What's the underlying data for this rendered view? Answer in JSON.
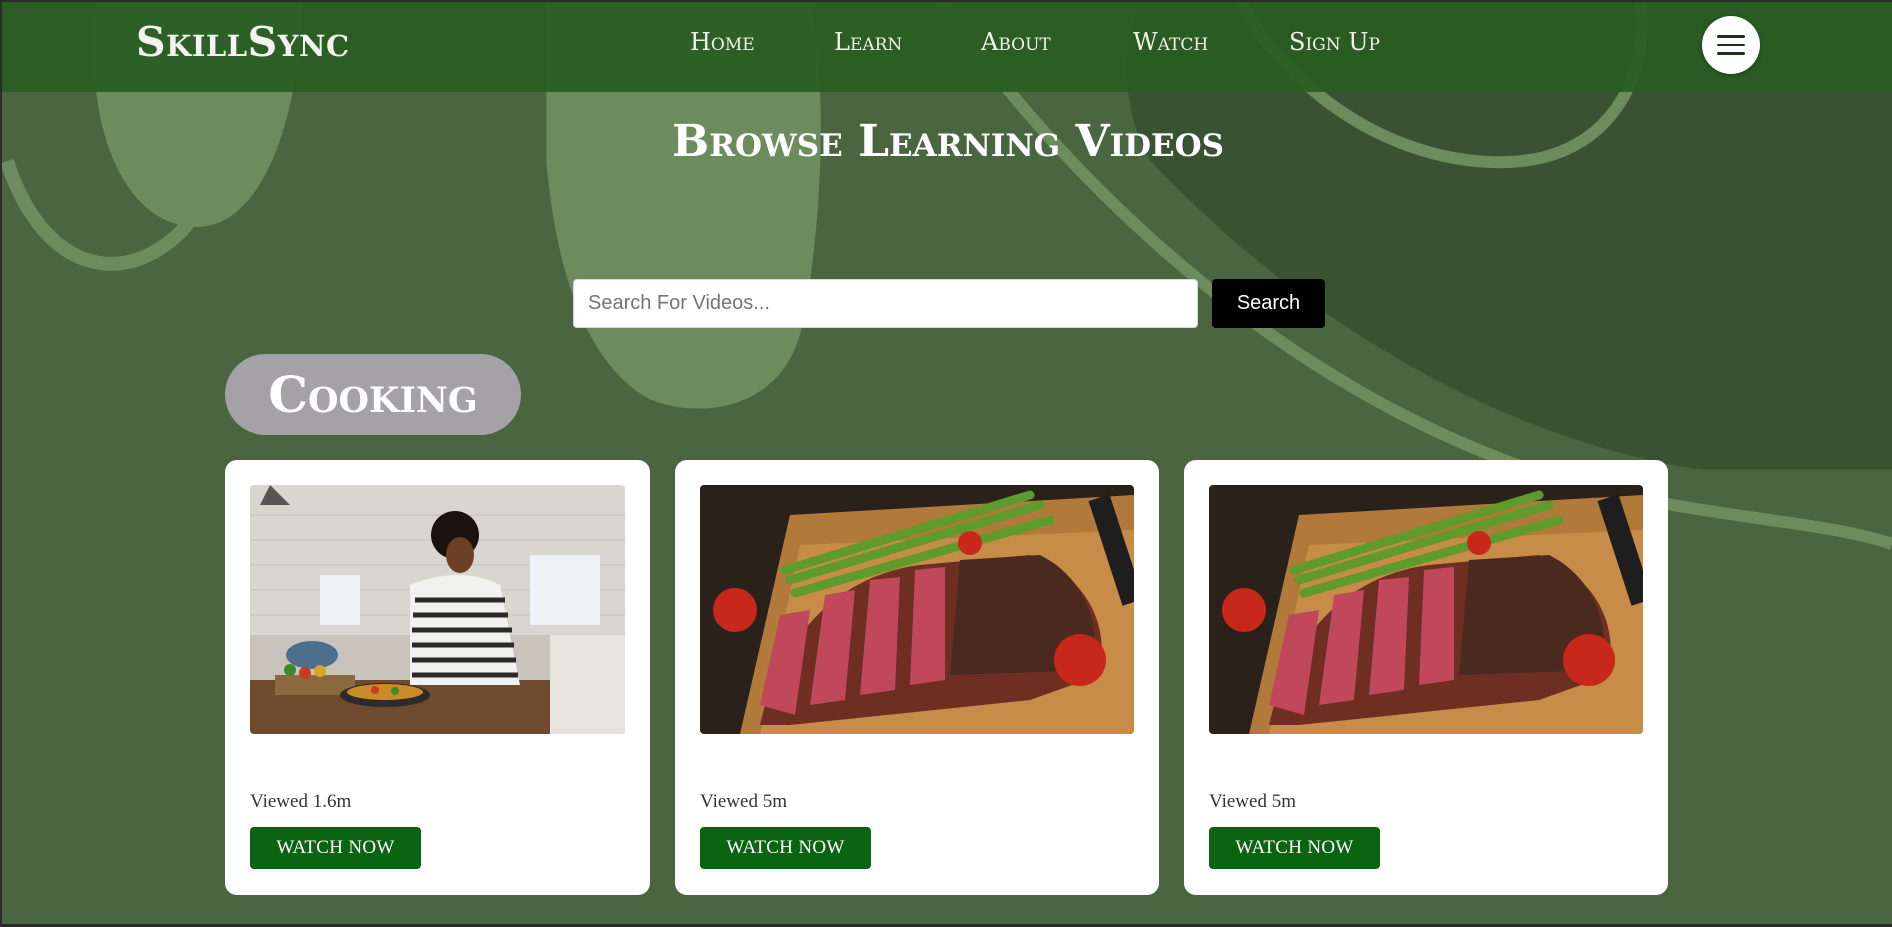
{
  "nav": {
    "brand": "SkillSync",
    "links": [
      "Home",
      "Learn",
      "About",
      "Watch",
      "Sign Up"
    ],
    "menu_icon": "hamburger-icon"
  },
  "page": {
    "title": "Browse Learning Videos"
  },
  "search": {
    "placeholder": "Search For Videos...",
    "button_label": "Search"
  },
  "category": {
    "name": "Cooking"
  },
  "cards": [
    {
      "thumbnail": "woman-cooking-in-kitchen",
      "views": "Viewed 1.6m",
      "button_label": "WATCH NOW"
    },
    {
      "thumbnail": "sliced-steak-with-asparagus",
      "views": "Viewed 5m",
      "button_label": "WATCH NOW"
    },
    {
      "thumbnail": "sliced-steak-with-asparagus",
      "views": "Viewed 5m",
      "button_label": "WATCH NOW"
    }
  ],
  "colors": {
    "background": "#44603d",
    "navbar": "#2b5c22",
    "accent_button": "#0b6411",
    "search_button": "#000000",
    "category_pill": "#a4a2a6"
  }
}
